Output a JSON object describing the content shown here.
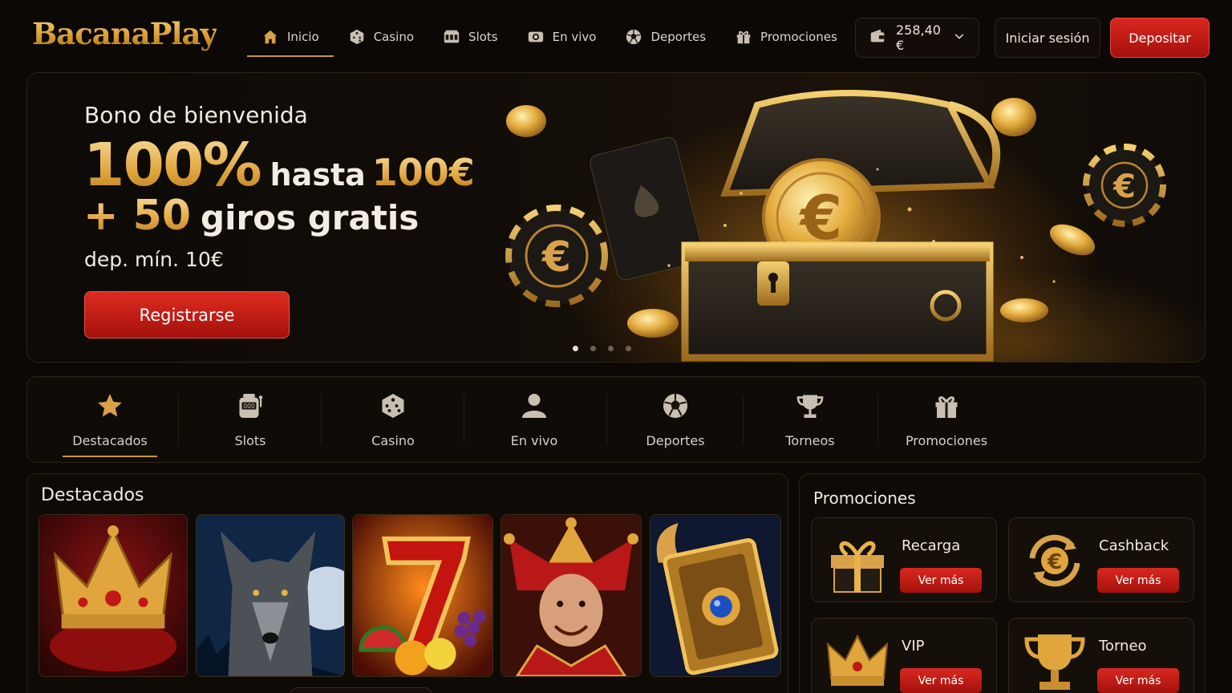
{
  "brand": {
    "logo": "BacanaPlay"
  },
  "nav": [
    {
      "label": "Inicio",
      "icon": "home-icon",
      "active": true
    },
    {
      "label": "Casino",
      "icon": "dice-icon"
    },
    {
      "label": "Slots",
      "icon": "slot-icon"
    },
    {
      "label": "En vivo",
      "icon": "live-camera-icon"
    },
    {
      "label": "Deportes",
      "icon": "soccer-ball-icon"
    },
    {
      "label": "Promociones",
      "icon": "gift-icon"
    }
  ],
  "wallet": {
    "balance": "258,40 €",
    "icon": "wallet-icon"
  },
  "auth": {
    "login_label": "Iniciar sesión",
    "deposit_label": "Depositar"
  },
  "hero": {
    "subtitle": "Bono de bienvenida",
    "percent": "100%",
    "hasta": "hasta",
    "amount": "100€",
    "plus_spins": "+ 50",
    "spins_text": "giros gratis",
    "min_deposit": "dep. mín. 10€",
    "cta": "Registrarse",
    "slides": 4,
    "active_slide": 1
  },
  "categories": [
    {
      "label": "Destacados",
      "icon": "star-icon",
      "active": true
    },
    {
      "label": "Slots",
      "icon": "slot-machine-icon"
    },
    {
      "label": "Casino",
      "icon": "dice-icon"
    },
    {
      "label": "En vivo",
      "icon": "person-icon"
    },
    {
      "label": "Deportes",
      "icon": "soccer-ball-icon"
    },
    {
      "label": "Torneos",
      "icon": "trophy-icon"
    },
    {
      "label": "Promociones",
      "icon": "gift-icon"
    }
  ],
  "featured": {
    "title": "Destacados",
    "games": [
      {
        "art": "crown-game-art"
      },
      {
        "art": "wolf-game-art"
      },
      {
        "art": "lucky-seven-game-art"
      },
      {
        "art": "jester-game-art"
      },
      {
        "art": "golden-book-game-art"
      }
    ]
  },
  "promotions": {
    "title": "Promociones",
    "items": [
      {
        "name": "Recarga",
        "button": "Ver más",
        "icon": "gift-box-icon"
      },
      {
        "name": "Cashback",
        "button": "Ver más",
        "icon": "euro-cycle-icon"
      },
      {
        "name": "VIP",
        "button": "Ver más",
        "icon": "crown-icon"
      },
      {
        "name": "Torneo",
        "button": "Ver más",
        "icon": "trophy-icon"
      }
    ]
  },
  "colors": {
    "gold": "#e0a53c",
    "red": "#c81a14",
    "background": "#0b0805"
  }
}
